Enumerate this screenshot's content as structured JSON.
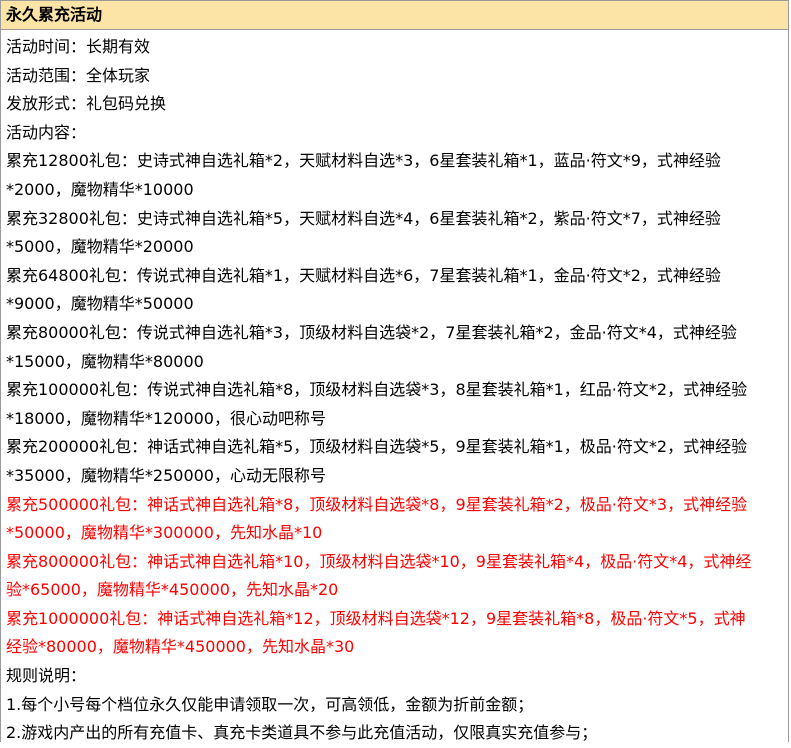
{
  "title": "永久累充活动",
  "lines": [
    {
      "text": "活动时间：长期有效",
      "color": "#000000"
    },
    {
      "text": "活动范围：全体玩家",
      "color": "#000000"
    },
    {
      "text": "发放形式：礼包码兑换",
      "color": "#000000"
    },
    {
      "text": "活动内容：",
      "color": "#000000"
    },
    {
      "text": "累充12800礼包：史诗式神自选礼箱*2，天赋材料自选*3，6星套装礼箱*1，蓝品·符文*9，式神经验",
      "color": "#000000"
    },
    {
      "text": "*2000，魔物精华*10000",
      "color": "#000000"
    },
    {
      "text": "累充32800礼包：史诗式神自选礼箱*5，天赋材料自选*4，6星套装礼箱*2，紫品·符文*7，式神经验",
      "color": "#000000"
    },
    {
      "text": "*5000，魔物精华*20000",
      "color": "#000000"
    },
    {
      "text": "累充64800礼包：传说式神自选礼箱*1，天赋材料自选*6，7星套装礼箱*1，金品·符文*2，式神经验",
      "color": "#000000"
    },
    {
      "text": "*9000，魔物精华*50000",
      "color": "#000000"
    },
    {
      "text": "累充80000礼包：传说式神自选礼箱*3，顶级材料自选袋*2，7星套装礼箱*2，金品·符文*4，式神经验",
      "color": "#000000"
    },
    {
      "text": "*15000，魔物精华*80000",
      "color": "#000000"
    },
    {
      "text": "累充100000礼包：传说式神自选礼箱*8，顶级材料自选袋*3，8星套装礼箱*1，红品·符文*2，式神经验",
      "color": "#000000"
    },
    {
      "text": "*18000，魔物精华*120000，很心动吧称号",
      "color": "#000000"
    },
    {
      "text": "累充200000礼包：神话式神自选礼箱*5，顶级材料自选袋*5，9星套装礼箱*1，极品·符文*2，式神经验",
      "color": "#000000"
    },
    {
      "text": "*35000，魔物精华*250000，心动无限称号",
      "color": "#000000"
    },
    {
      "text": "累充500000礼包：神话式神自选礼箱*8，顶级材料自选袋*8，9星套装礼箱*2，极品·符文*3，式神经验",
      "color": "#ff0000"
    },
    {
      "text": "*50000，魔物精华*300000，先知水晶*10",
      "color": "#ff0000"
    },
    {
      "text": "累充800000礼包：神话式神自选礼箱*10，顶级材料自选袋*10，9星套装礼箱*4，极品·符文*4，式神经",
      "color": "#ff0000"
    },
    {
      "text": "验*65000，魔物精华*450000，先知水晶*20",
      "color": "#ff0000"
    },
    {
      "text": "累充1000000礼包：神话式神自选礼箱*12，顶级材料自选袋*12，9星套装礼箱*8，极品·符文*5，式神",
      "color": "#ff0000"
    },
    {
      "text": "经验*80000，魔物精华*450000，先知水晶*30",
      "color": "#ff0000"
    },
    {
      "text": "规则说明：",
      "color": "#000000"
    },
    {
      "text": "1.每个小号每个档位永久仅能申请领取一次，可高领低，金额为折前金额；",
      "color": "#000000"
    },
    {
      "text": "2.游戏内产出的所有充值卡、真充卡类道具不参与此充值活动，仅限真实充值参与；",
      "color": "#000000"
    }
  ]
}
